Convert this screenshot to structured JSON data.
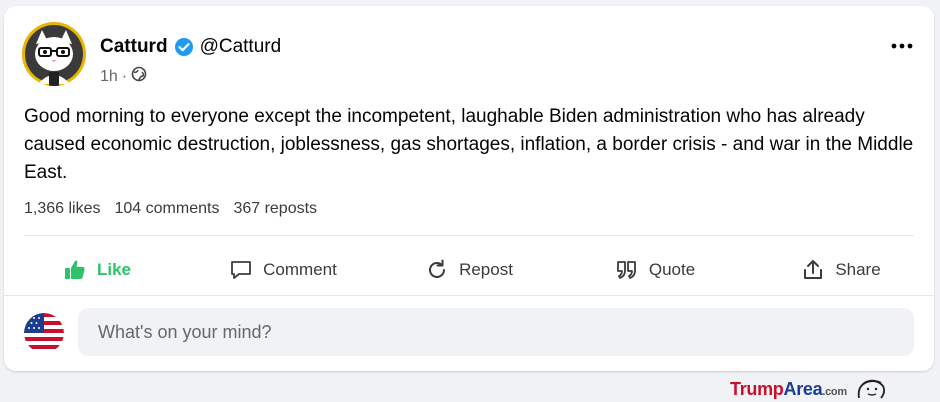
{
  "post": {
    "author": "Catturd",
    "handle": "@Catturd",
    "time": "1h",
    "separator": "·",
    "text": "Good morning to everyone except the incompetent, laughable Biden administration who has already caused economic destruction, joblessness, gas shortages, inflation, a border crisis - and war in the Middle East.",
    "stats": {
      "likes": "1,366 likes",
      "comments": "104 comments",
      "reposts": "367 reposts"
    }
  },
  "actions": {
    "like": "Like",
    "comment": "Comment",
    "repost": "Repost",
    "quote": "Quote",
    "share": "Share"
  },
  "composer": {
    "placeholder": "What's on your mind?"
  },
  "watermark": {
    "part1": "Trump",
    "part2": "Area",
    "part3": ".com"
  },
  "colors": {
    "like_green": "#2ec36b",
    "verified_blue": "#1d9bf0",
    "avatar_ring": "#e8b500"
  },
  "icons": [
    "verified-badge-icon",
    "globe-icon",
    "more-icon",
    "thumbs-up-icon",
    "comment-icon",
    "repost-icon",
    "quote-icon",
    "share-icon",
    "flag-avatar"
  ]
}
